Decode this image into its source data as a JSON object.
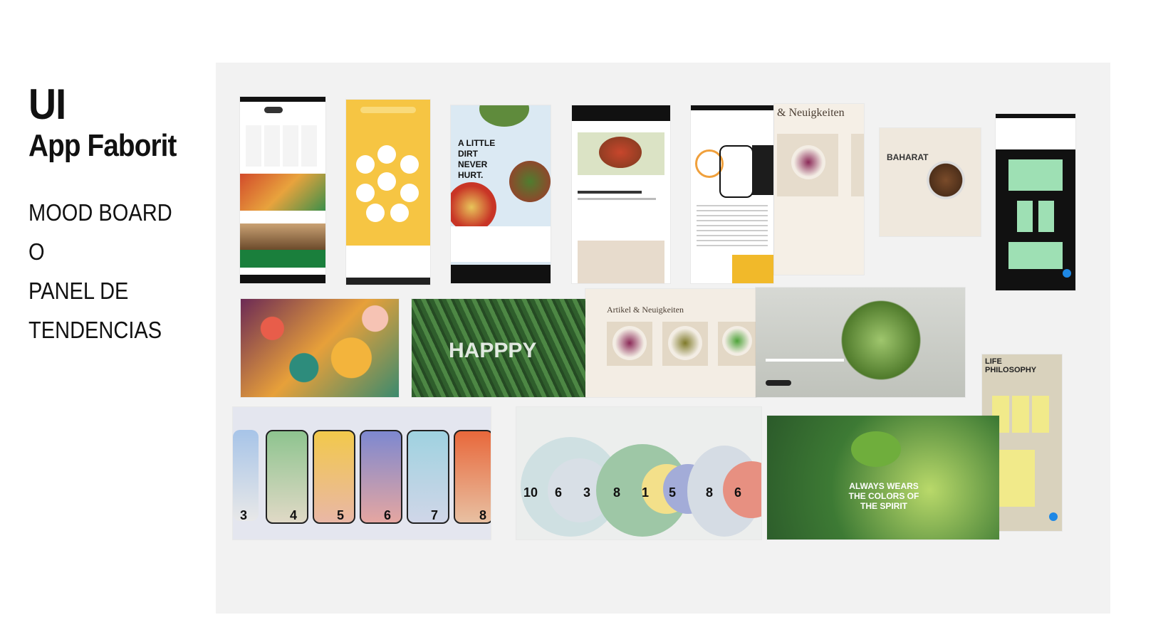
{
  "sidebar": {
    "title": "UI",
    "subtitle": "App Faborit",
    "lines": [
      "MOOD BOARD",
      "O",
      "PANEL DE",
      "TENDENCIAS"
    ]
  },
  "board": {
    "tiles": {
      "dirt": "A LITTLE DIRT NEVER HURT.",
      "kaffee": "& Neuigkeiten",
      "baharat": "BAHARAT",
      "happy": "HAPPPY",
      "artikel": "Artikel & Neuigkeiten",
      "life": "LIFE PHILOSOPHY",
      "chameleon": "ALWAYS WEARS THE COLORS OF THE SPIRIT",
      "numbers": [
        "10",
        "6",
        "3",
        "8",
        "1",
        "5",
        "8",
        "6"
      ],
      "phones": [
        "3",
        "4",
        "5",
        "6",
        "7",
        "8"
      ]
    }
  },
  "colors": {
    "board_bg": "#f2f2f2",
    "yellow": "#f6c543",
    "green": "#1a7f3c",
    "beige": "#efe8dd"
  }
}
